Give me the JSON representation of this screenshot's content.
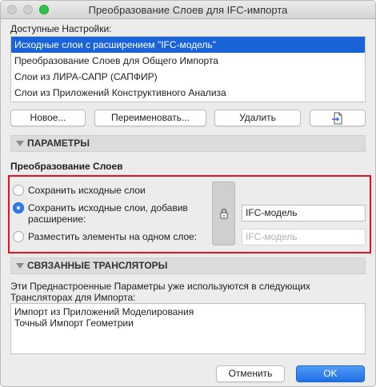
{
  "window": {
    "title": "Преобразование Слоев для IFC-импорта"
  },
  "available_settings": {
    "label": "Доступные Настройки:",
    "items": [
      "Исходные слои с расширением \"IFC-модель\"",
      "Преобразование Слоев для Общего Импорта",
      "Слои из ЛИРА-САПР (САПФИР)",
      "Слои из Приложений Конструктивного Анализа"
    ],
    "selected_index": 0
  },
  "buttons": {
    "new": "Новое...",
    "rename": "Переименовать...",
    "delete": "Удалить",
    "cancel": "Отменить",
    "ok": "OK"
  },
  "parameters": {
    "section_title": "ПАРАМЕТРЫ",
    "subtitle": "Преобразование Слоев",
    "options": [
      "Сохранить исходные слои",
      "Сохранить исходные слои, добавив",
      "расширение:",
      "Разместить элементы на одном слое:"
    ],
    "selected_option": 1,
    "extension_value": "IFC-модель",
    "single_layer_value": "IFC-модель"
  },
  "translators": {
    "section_title": "СВЯЗАННЫЕ ТРАНСЛЯТОРЫ",
    "description_line1": "Эти Преднастроенные Параметры уже используются в следующих",
    "description_line2": "Трансляторах для Импорта:",
    "items": [
      "Импорт из Приложений Моделирования",
      "Точный Импорт Геометрии"
    ]
  },
  "colors": {
    "selection": "#1a62d8",
    "highlight_frame": "#e0161f",
    "primary_button": "#1f6fe5"
  }
}
